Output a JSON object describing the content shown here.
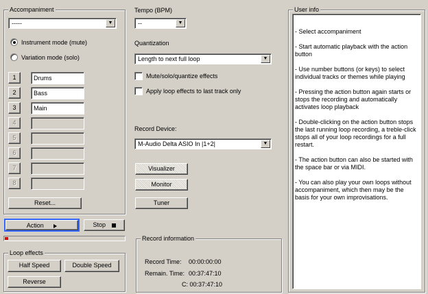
{
  "accompaniment": {
    "legend": "Accompaniment",
    "selected": "-----",
    "radio_instrument": "Instrument mode (mute)",
    "radio_variation": "Variation mode (solo)",
    "selected_mode": "instrument",
    "tracks": [
      {
        "num": "1",
        "name": "Drums",
        "enabled": true
      },
      {
        "num": "2",
        "name": "Bass",
        "enabled": true
      },
      {
        "num": "3",
        "name": "Main",
        "enabled": true
      },
      {
        "num": "4",
        "name": "",
        "enabled": false
      },
      {
        "num": "5",
        "name": "",
        "enabled": false
      },
      {
        "num": "6",
        "name": "",
        "enabled": false
      },
      {
        "num": "7",
        "name": "",
        "enabled": false
      },
      {
        "num": "8",
        "name": "",
        "enabled": false
      }
    ],
    "reset_label": "Reset..."
  },
  "transport": {
    "action_label": "Action",
    "action_icon": "play-arrow-icon",
    "stop_label": "Stop",
    "stop_icon": "stop-square-icon",
    "progress": 0.03,
    "progress_color": "#e00000",
    "focus_color": "#3366ff"
  },
  "loop_effects": {
    "legend": "Loop effects",
    "half_speed": "Half Speed",
    "double_speed": "Double Speed",
    "reverse": "Reverse"
  },
  "tempo": {
    "label": "Tempo (BPM)",
    "value": "--"
  },
  "quantization": {
    "label": "Quantization",
    "value": "Length to next full loop",
    "mute_solo_label": "Mute/solo/quantize effects",
    "mute_solo_checked": false,
    "apply_last_label": "Apply loop effects to last track only",
    "apply_last_checked": false
  },
  "record_device": {
    "label": "Record Device:",
    "value": "M-Audio Delta ASIO In |1+2|",
    "visualizer": "Visualizer",
    "monitor": "Monitor",
    "tuner": "Tuner"
  },
  "record_info": {
    "legend": "Record information",
    "record_time_label": "Record Time:",
    "record_time_value": "00:00:00:00",
    "remain_time_label": "Remain. Time:",
    "remain_time_value": "00:37:47:10",
    "c_value": "C: 00:37:47:10"
  },
  "user_info": {
    "legend": "User info",
    "paragraphs": [
      "- Select accompaniment",
      "- Start automatic playback with the action button",
      "- Use number buttons (or keys) to select individual tracks or themes while playing",
      "- Pressing the action button again starts or stops the recording and automatically activates loop playback",
      "- Double-clicking on the action button stops the last running loop recording, a treble-click stops all of your loop recordings for a full restart.",
      "- The action button can also be started with the space bar or via MIDI.",
      "- You can also play your own loops without accompaniment, which then may be the basis for your own improvisations."
    ]
  }
}
